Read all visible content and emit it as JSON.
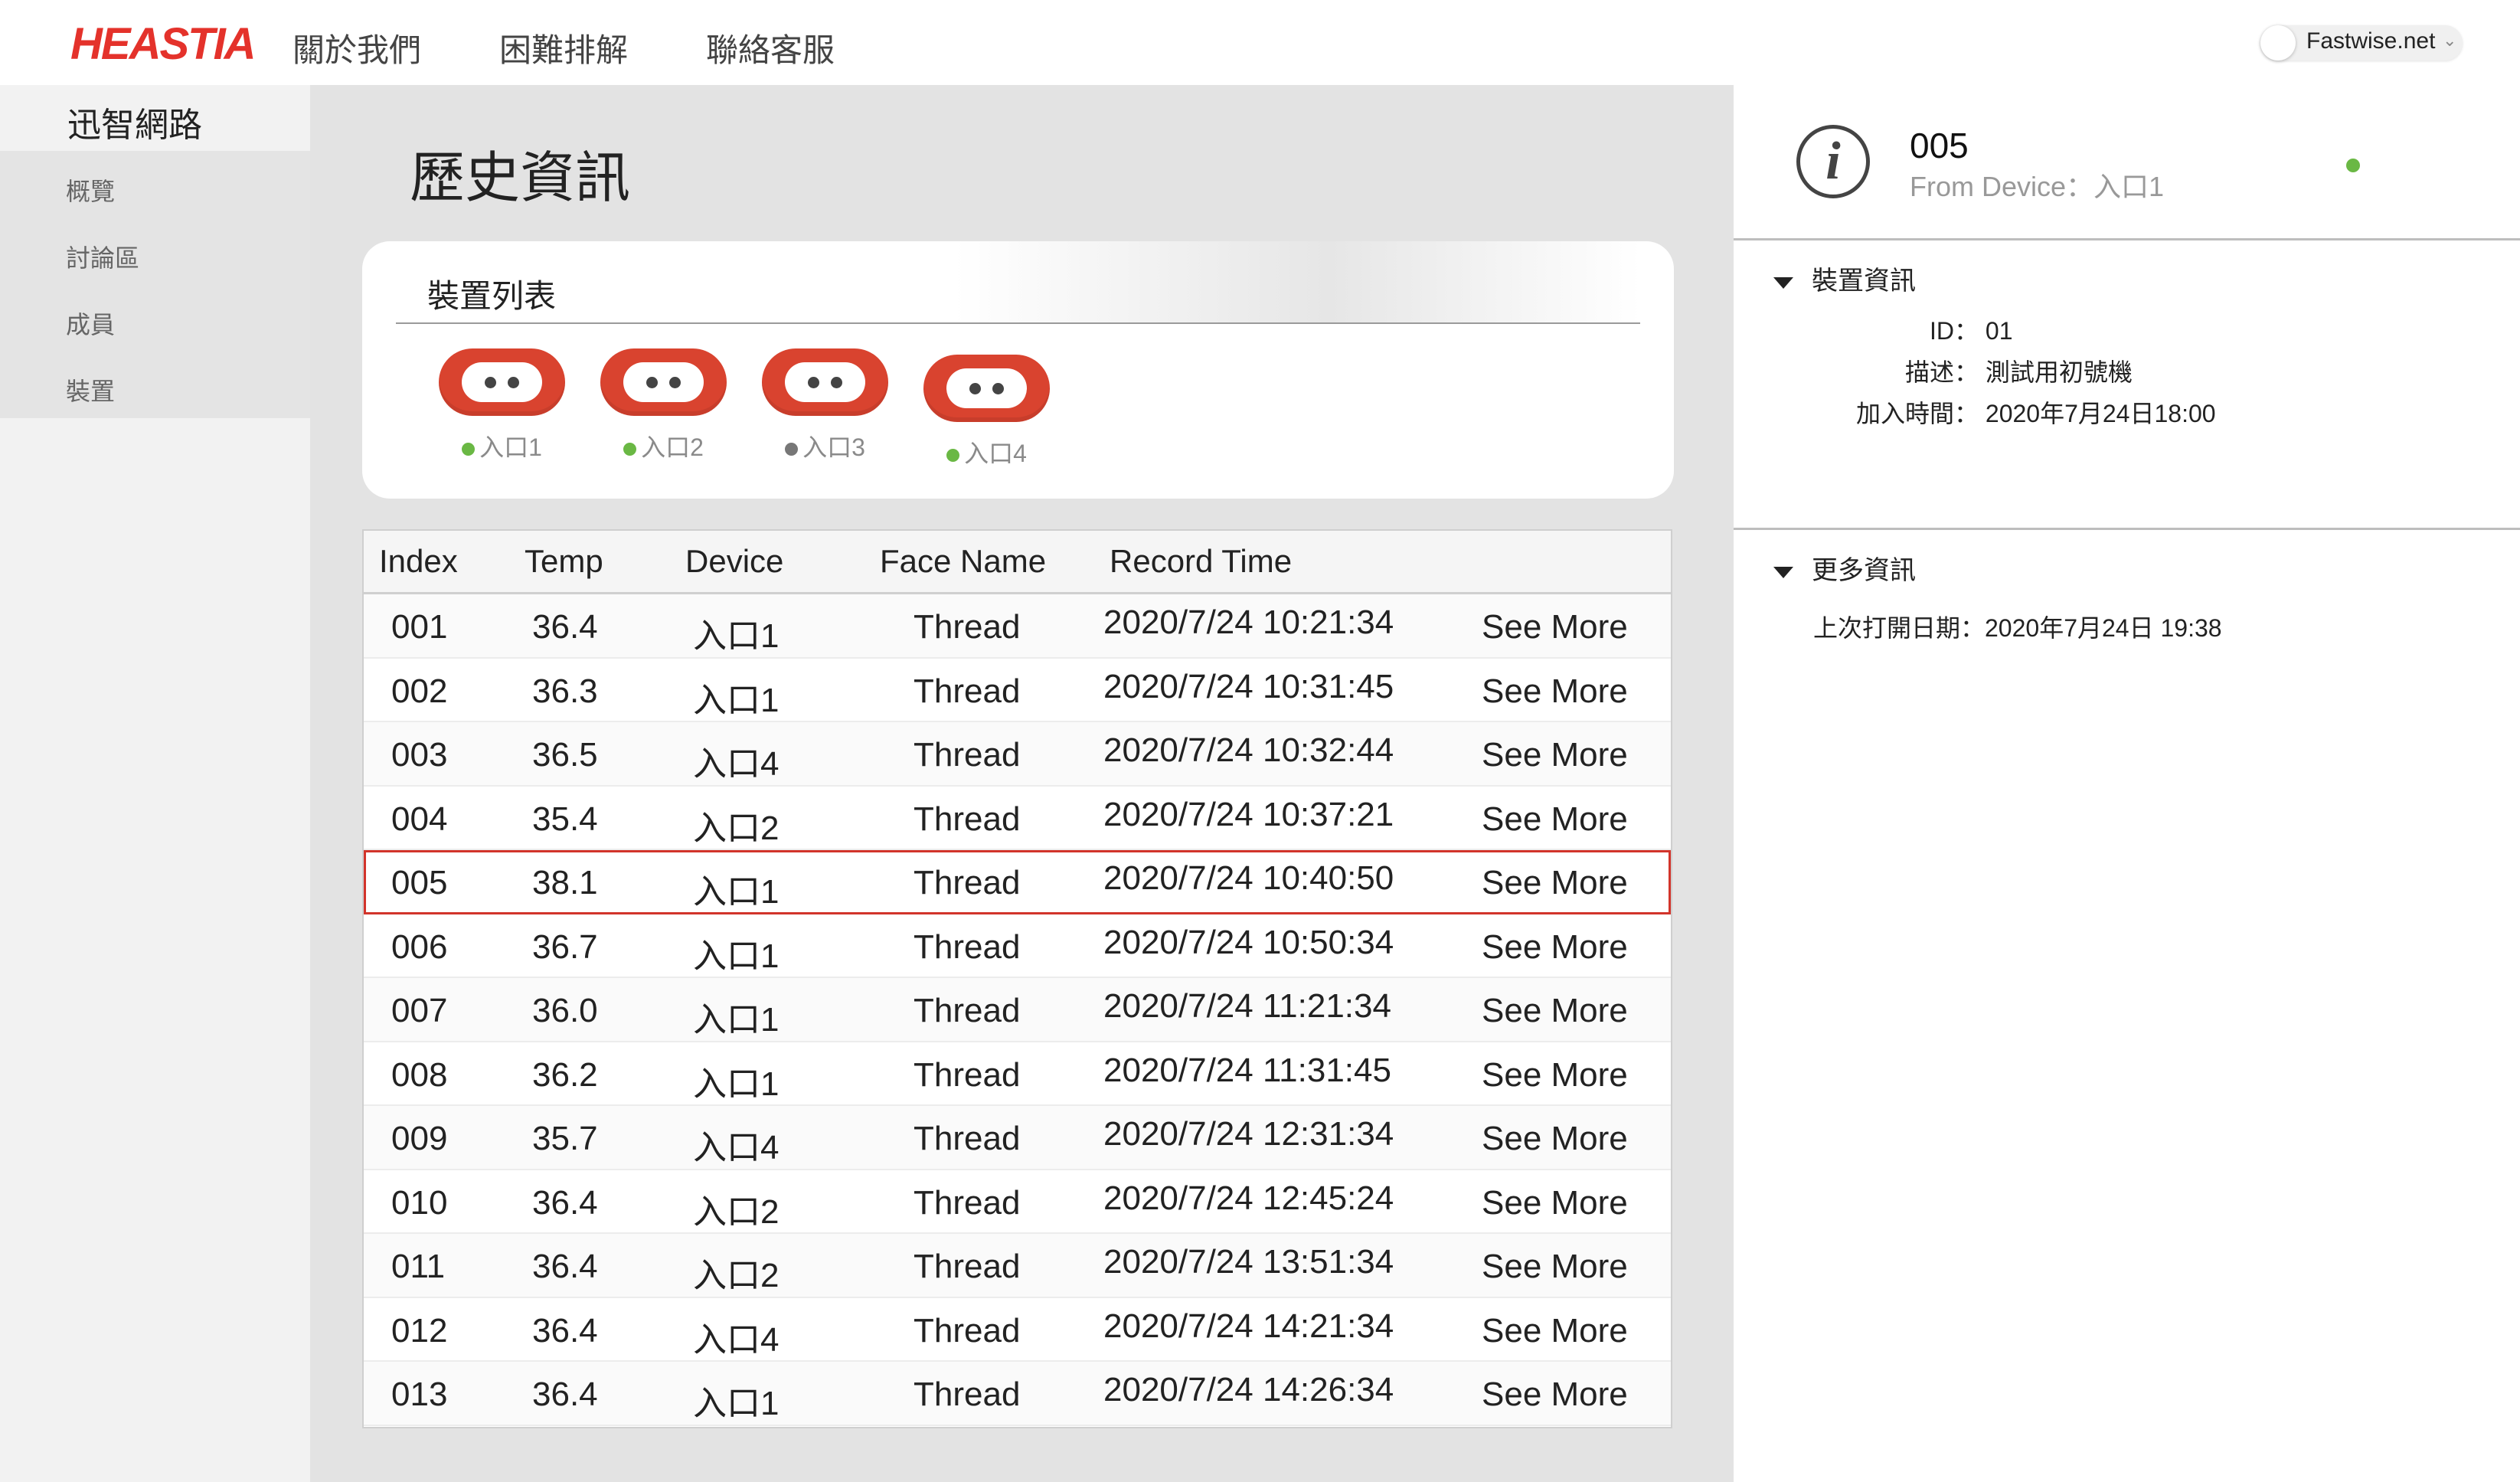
{
  "brand": {
    "logo": "HEASTIA",
    "accent_color": "#e4322b"
  },
  "topnav": [
    "關於我們",
    "困難排解",
    "聯絡客服"
  ],
  "account": {
    "domain": "Fastwise.net",
    "caret": "⌄"
  },
  "sidebar": {
    "title": "迅智網路",
    "items": [
      {
        "label": "概覽"
      },
      {
        "label": "討論區"
      },
      {
        "label": "成員"
      },
      {
        "label": "裝置"
      }
    ]
  },
  "main": {
    "title": "歷史資訊",
    "device_list": {
      "title": "裝置列表",
      "devices": [
        {
          "label": "入口1",
          "status": "online",
          "status_color": "#6ab844"
        },
        {
          "label": "入口2",
          "status": "online",
          "status_color": "#6ab844"
        },
        {
          "label": "入口3",
          "status": "offline",
          "status_color": "#777777"
        },
        {
          "label": "入口4",
          "status": "online",
          "status_color": "#6ab844"
        }
      ]
    },
    "table": {
      "headers": [
        "Index",
        "Temp",
        "Device",
        "Face Name",
        "Record Time"
      ],
      "action_label": "See More",
      "selected_index": "005",
      "rows": [
        {
          "index": "001",
          "temp": "36.4",
          "device": "入口1",
          "face": "Thread",
          "time": "2020/7/24 10:21:34"
        },
        {
          "index": "002",
          "temp": "36.3",
          "device": "入口1",
          "face": "Thread",
          "time": "2020/7/24 10:31:45"
        },
        {
          "index": "003",
          "temp": "36.5",
          "device": "入口4",
          "face": "Thread",
          "time": "2020/7/24 10:32:44"
        },
        {
          "index": "004",
          "temp": "35.4",
          "device": "入口2",
          "face": "Thread",
          "time": "2020/7/24 10:37:21"
        },
        {
          "index": "005",
          "temp": "38.1",
          "device": "入口1",
          "face": "Thread",
          "time": "2020/7/24 10:40:50"
        },
        {
          "index": "006",
          "temp": "36.7",
          "device": "入口1",
          "face": "Thread",
          "time": "2020/7/24 10:50:34"
        },
        {
          "index": "007",
          "temp": "36.0",
          "device": "入口1",
          "face": "Thread",
          "time": "2020/7/24 11:21:34"
        },
        {
          "index": "008",
          "temp": "36.2",
          "device": "入口1",
          "face": "Thread",
          "time": "2020/7/24 11:31:45"
        },
        {
          "index": "009",
          "temp": "35.7",
          "device": "入口4",
          "face": "Thread",
          "time": "2020/7/24 12:31:34"
        },
        {
          "index": "010",
          "temp": "36.4",
          "device": "入口2",
          "face": "Thread",
          "time": "2020/7/24 12:45:24"
        },
        {
          "index": "011",
          "temp": "36.4",
          "device": "入口2",
          "face": "Thread",
          "time": "2020/7/24 13:51:34"
        },
        {
          "index": "012",
          "temp": "36.4",
          "device": "入口4",
          "face": "Thread",
          "time": "2020/7/24 14:21:34"
        },
        {
          "index": "013",
          "temp": "36.4",
          "device": "入口1",
          "face": "Thread",
          "time": "2020/7/24 14:26:34"
        }
      ]
    }
  },
  "detail": {
    "index": "005",
    "from_device": "From Device：入口1",
    "status_color": "#6ab844",
    "device_info": {
      "title": "裝置資訊",
      "id_key": "ID：",
      "id_value": "01",
      "desc_key": "描述：",
      "desc_value": "測試用初號機",
      "joined_key": "加入時間：",
      "joined_value": "2020年7月24日18:00"
    },
    "more_info": {
      "title": "更多資訊",
      "last_opened": "上次打開日期：2020年7月24日 19:38"
    }
  }
}
